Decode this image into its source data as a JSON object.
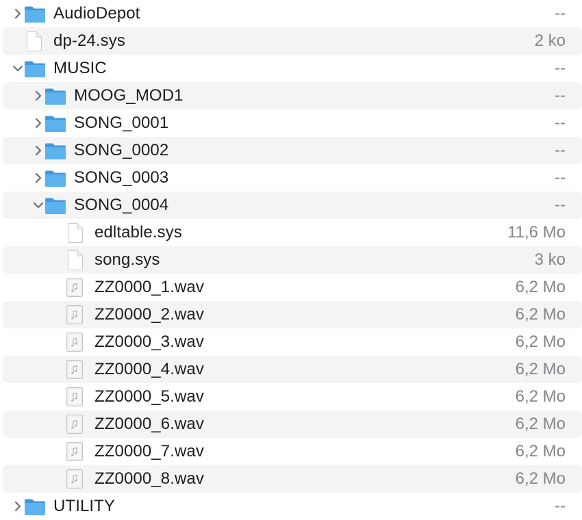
{
  "colors": {
    "row_alt_background": "#f4f4f5",
    "folder_blue": "#5cb2ee",
    "size_text": "#85858a"
  },
  "rows": [
    {
      "name": "AudioDepot",
      "size": "--",
      "kind": "folder",
      "depth": 0,
      "expanded": false
    },
    {
      "name": "dp-24.sys",
      "size": "2 ko",
      "kind": "file",
      "depth": 0
    },
    {
      "name": "MUSIC",
      "size": "--",
      "kind": "folder",
      "depth": 0,
      "expanded": true
    },
    {
      "name": "MOOG_MOD1",
      "size": "--",
      "kind": "folder",
      "depth": 1,
      "expanded": false
    },
    {
      "name": "SONG_0001",
      "size": "--",
      "kind": "folder",
      "depth": 1,
      "expanded": false
    },
    {
      "name": "SONG_0002",
      "size": "--",
      "kind": "folder",
      "depth": 1,
      "expanded": false
    },
    {
      "name": "SONG_0003",
      "size": "--",
      "kind": "folder",
      "depth": 1,
      "expanded": false
    },
    {
      "name": "SONG_0004",
      "size": "--",
      "kind": "folder",
      "depth": 1,
      "expanded": true
    },
    {
      "name": "edltable.sys",
      "size": "11,6 Mo",
      "kind": "file",
      "depth": 2
    },
    {
      "name": "song.sys",
      "size": "3 ko",
      "kind": "file",
      "depth": 2
    },
    {
      "name": "ZZ0000_1.wav",
      "size": "6,2 Mo",
      "kind": "audio",
      "depth": 2
    },
    {
      "name": "ZZ0000_2.wav",
      "size": "6,2 Mo",
      "kind": "audio",
      "depth": 2
    },
    {
      "name": "ZZ0000_3.wav",
      "size": "6,2 Mo",
      "kind": "audio",
      "depth": 2
    },
    {
      "name": "ZZ0000_4.wav",
      "size": "6,2 Mo",
      "kind": "audio",
      "depth": 2
    },
    {
      "name": "ZZ0000_5.wav",
      "size": "6,2 Mo",
      "kind": "audio",
      "depth": 2
    },
    {
      "name": "ZZ0000_6.wav",
      "size": "6,2 Mo",
      "kind": "audio",
      "depth": 2
    },
    {
      "name": "ZZ0000_7.wav",
      "size": "6,2 Mo",
      "kind": "audio",
      "depth": 2
    },
    {
      "name": "ZZ0000_8.wav",
      "size": "6,2 Mo",
      "kind": "audio",
      "depth": 2
    },
    {
      "name": "UTILITY",
      "size": "--",
      "kind": "folder",
      "depth": 0,
      "expanded": false
    }
  ]
}
